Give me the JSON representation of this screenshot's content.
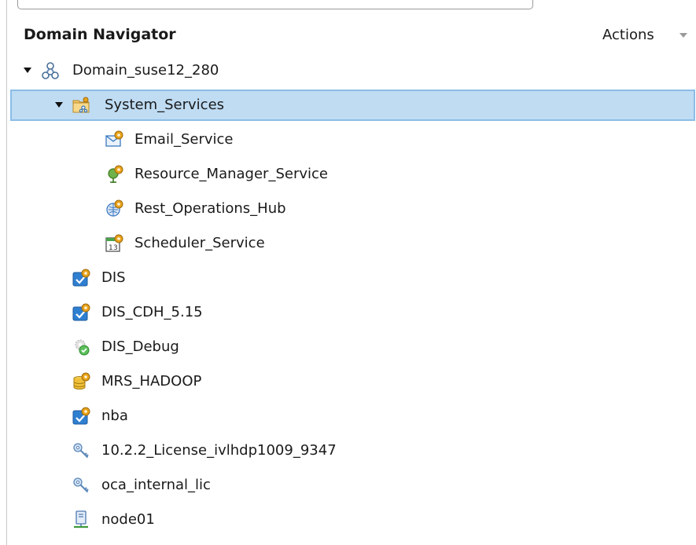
{
  "navigator": {
    "title": "Domain Navigator",
    "actions_label": "Actions"
  },
  "tree": {
    "domain": {
      "label": "Domain_suse12_280",
      "icon": "domain-network-icon",
      "expanded": true
    },
    "folder": {
      "label": "System_Services",
      "icon": "services-folder-icon",
      "expanded": true,
      "selected": true
    },
    "services": [
      {
        "label": "Email_Service",
        "icon": "email-service-icon"
      },
      {
        "label": "Resource_Manager_Service",
        "icon": "resource-manager-icon"
      },
      {
        "label": "Rest_Operations_Hub",
        "icon": "rest-hub-icon"
      },
      {
        "label": "Scheduler_Service",
        "icon": "scheduler-icon"
      }
    ],
    "items": [
      {
        "label": "DIS",
        "icon": "integration-service-icon"
      },
      {
        "label": "DIS_CDH_5.15",
        "icon": "integration-service-icon"
      },
      {
        "label": "DIS_Debug",
        "icon": "service-enabled-icon"
      },
      {
        "label": "MRS_HADOOP",
        "icon": "model-repository-icon"
      },
      {
        "label": "nba",
        "icon": "integration-service-icon"
      },
      {
        "label": "10.2.2_License_ivlhdp1009_9347",
        "icon": "license-key-icon"
      },
      {
        "label": "oca_internal_lic",
        "icon": "license-key-icon"
      },
      {
        "label": "node01",
        "icon": "node-icon"
      }
    ]
  },
  "colors": {
    "selection_bg": "#bfdcf3",
    "selection_border": "#8cbde6",
    "service_gear": "#e8a21a",
    "service_blue": "#2f7fd1"
  }
}
